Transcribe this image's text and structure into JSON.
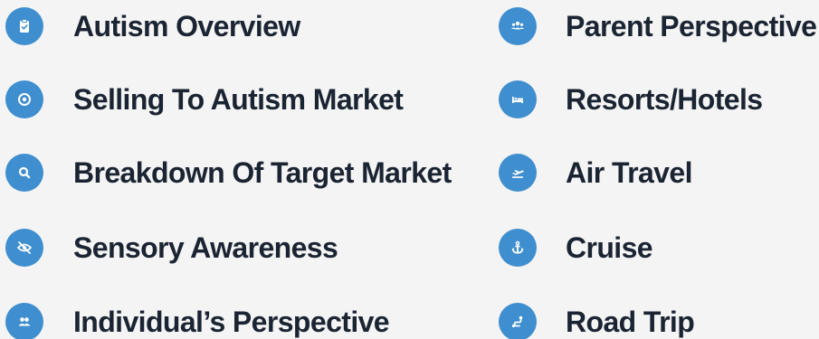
{
  "left_items": [
    {
      "label": "Autism Overview",
      "icon": "clipboard-icon"
    },
    {
      "label": "Selling To Autism Market",
      "icon": "target-icon"
    },
    {
      "label": "Breakdown Of Target Market",
      "icon": "search-icon"
    },
    {
      "label": "Sensory Awareness",
      "icon": "eye-slash-icon"
    },
    {
      "label": "Individual’s Perspective",
      "icon": "users-icon"
    }
  ],
  "right_items": [
    {
      "label": "Parent Perspective",
      "icon": "group-icon"
    },
    {
      "label": "Resorts/Hotels",
      "icon": "bed-icon"
    },
    {
      "label": "Air Travel",
      "icon": "plane-departure-icon"
    },
    {
      "label": "Cruise",
      "icon": "anchor-icon"
    },
    {
      "label": "Road Trip",
      "icon": "route-icon"
    }
  ],
  "colors": {
    "badge": "#3f8ecf",
    "text": "#1b2433",
    "background": "#f4f4f4"
  }
}
